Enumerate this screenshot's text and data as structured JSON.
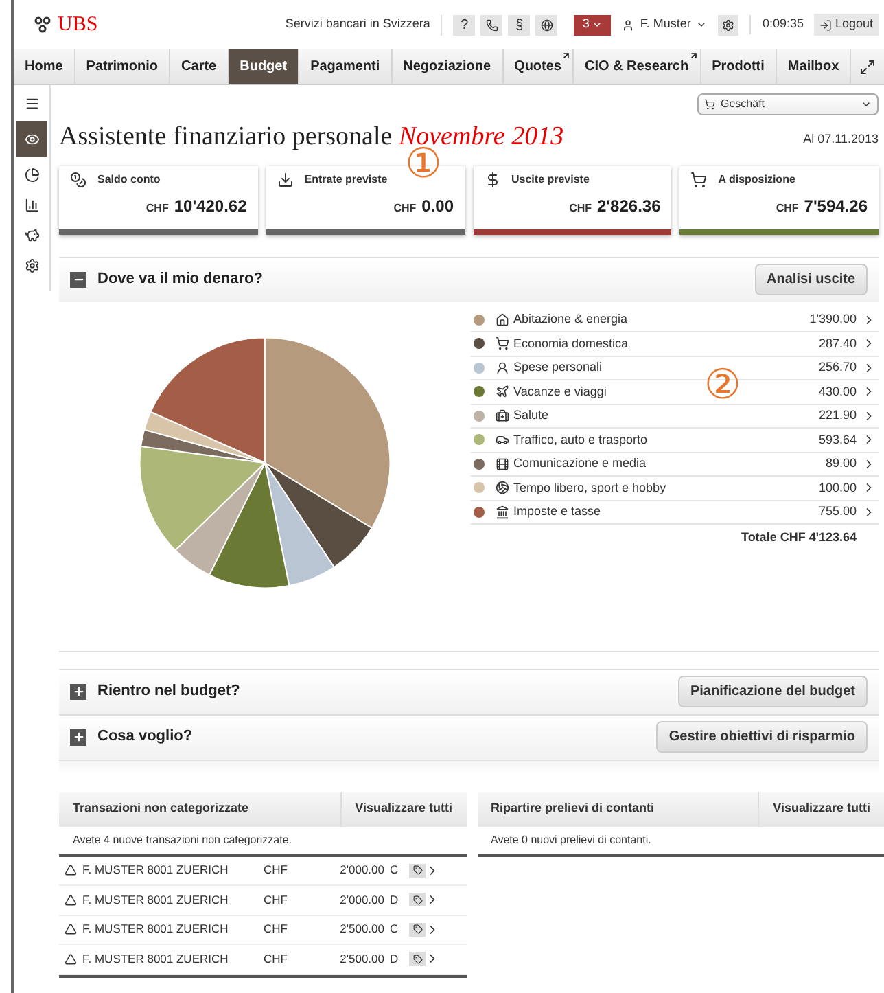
{
  "header": {
    "logo": "UBS",
    "region": "Servizi bancari in Svizzera",
    "tools": [
      "?",
      "§"
    ],
    "notifications": "3",
    "user": "F. Muster",
    "time": "0:09:35",
    "logout": "Logout"
  },
  "nav": [
    {
      "label": "Home",
      "selected": false,
      "external": false
    },
    {
      "label": "Patrimonio",
      "selected": false,
      "external": false
    },
    {
      "label": "Carte",
      "selected": false,
      "external": false
    },
    {
      "label": "Budget",
      "selected": true,
      "external": false
    },
    {
      "label": "Pagamenti",
      "selected": false,
      "external": false
    },
    {
      "label": "Negoziazione",
      "selected": false,
      "external": false
    },
    {
      "label": "Quotes",
      "selected": false,
      "external": true
    },
    {
      "label": "CIO & Research",
      "selected": false,
      "external": true
    },
    {
      "label": "Prodotti",
      "selected": false,
      "external": false
    },
    {
      "label": "Mailbox",
      "selected": false,
      "external": false
    }
  ],
  "sidebar": [
    {
      "kind": "list",
      "selected": false
    },
    {
      "kind": "eye",
      "selected": true
    },
    {
      "kind": "pie",
      "selected": false
    },
    {
      "kind": "bars",
      "selected": false
    },
    {
      "kind": "piggy",
      "selected": false
    },
    {
      "kind": "gear",
      "selected": false
    }
  ],
  "profile_select": "Geschäft",
  "title": "Assistente finanziario personale",
  "title_month": "Novembre 2013",
  "date": "Al 07.11.2013",
  "annotations": [
    "①",
    "②"
  ],
  "cards": [
    {
      "kind": "coins",
      "label": "Saldo conto",
      "currency": "CHF",
      "amount": "10'420.62",
      "color": "#666666"
    },
    {
      "kind": "income",
      "label": "Entrate previste",
      "currency": "CHF",
      "amount": "0.00",
      "color": "#666666"
    },
    {
      "kind": "dollar",
      "label": "Uscite previste",
      "currency": "CHF",
      "amount": "2'826.36",
      "color": "#a03a36"
    },
    {
      "kind": "cart",
      "label": "A disposizione",
      "currency": "CHF",
      "amount": "7'594.26",
      "color": "#6b7d35"
    }
  ],
  "spending": {
    "title": "Dove va il mio denaro?",
    "expanded": true,
    "button": "Analisi uscite",
    "items": [
      {
        "kind": "house",
        "label": "Abitazione & energia",
        "amount": "1'390.00",
        "color": "#b59a7e"
      },
      {
        "kind": "cart",
        "label": "Economia domestica",
        "amount": "287.40",
        "color": "#5a4e42"
      },
      {
        "kind": "person",
        "label": "Spese personali",
        "amount": "256.70",
        "color": "#b9c5d3"
      },
      {
        "kind": "plane",
        "label": "Vacanze e viaggi",
        "amount": "430.00",
        "color": "#6a7a35"
      },
      {
        "kind": "medkit",
        "label": "Salute",
        "amount": "221.90",
        "color": "#bdb2a5"
      },
      {
        "kind": "car",
        "label": "Traffico, auto e trasporto",
        "amount": "593.64",
        "color": "#adb777"
      },
      {
        "kind": "media",
        "label": "Comunicazione e media",
        "amount": "89.00",
        "color": "#7b6c5f"
      },
      {
        "kind": "ball",
        "label": "Tempo libero, sport e hobby",
        "amount": "100.00",
        "color": "#d8c4a8"
      },
      {
        "kind": "tax",
        "label": "Imposte e tasse",
        "amount": "755.00",
        "color": "#a45e48"
      }
    ],
    "total": "Totale CHF 4'123.64"
  },
  "sections": [
    {
      "title": "Rientro nel budget?",
      "expanded": false,
      "button": "Pianificazione del budget"
    },
    {
      "title": "Cosa voglio?",
      "expanded": false,
      "button": "Gestire obiettivi di risparmio"
    }
  ],
  "uncategorized": {
    "title": "Transazioni non categorizzate",
    "link": "Visualizzare tutti",
    "message": "Avete 4 nuove transazioni non categorizzate.",
    "rows": [
      {
        "name": "F. MUSTER 8001 ZUERICH",
        "currency": "CHF",
        "amount": "2'000.00",
        "type": "C"
      },
      {
        "name": "F. MUSTER 8001 ZUERICH",
        "currency": "CHF",
        "amount": "2'000.00",
        "type": "D"
      },
      {
        "name": "F. MUSTER 8001 ZUERICH",
        "currency": "CHF",
        "amount": "2'500.00",
        "type": "C"
      },
      {
        "name": "F. MUSTER 8001 ZUERICH",
        "currency": "CHF",
        "amount": "2'500.00",
        "type": "D"
      }
    ]
  },
  "cash": {
    "title": "Ripartire prelievi di contanti",
    "link": "Visualizzare tutti",
    "message": "Avete 0 nuovi prelievi di contanti."
  }
}
